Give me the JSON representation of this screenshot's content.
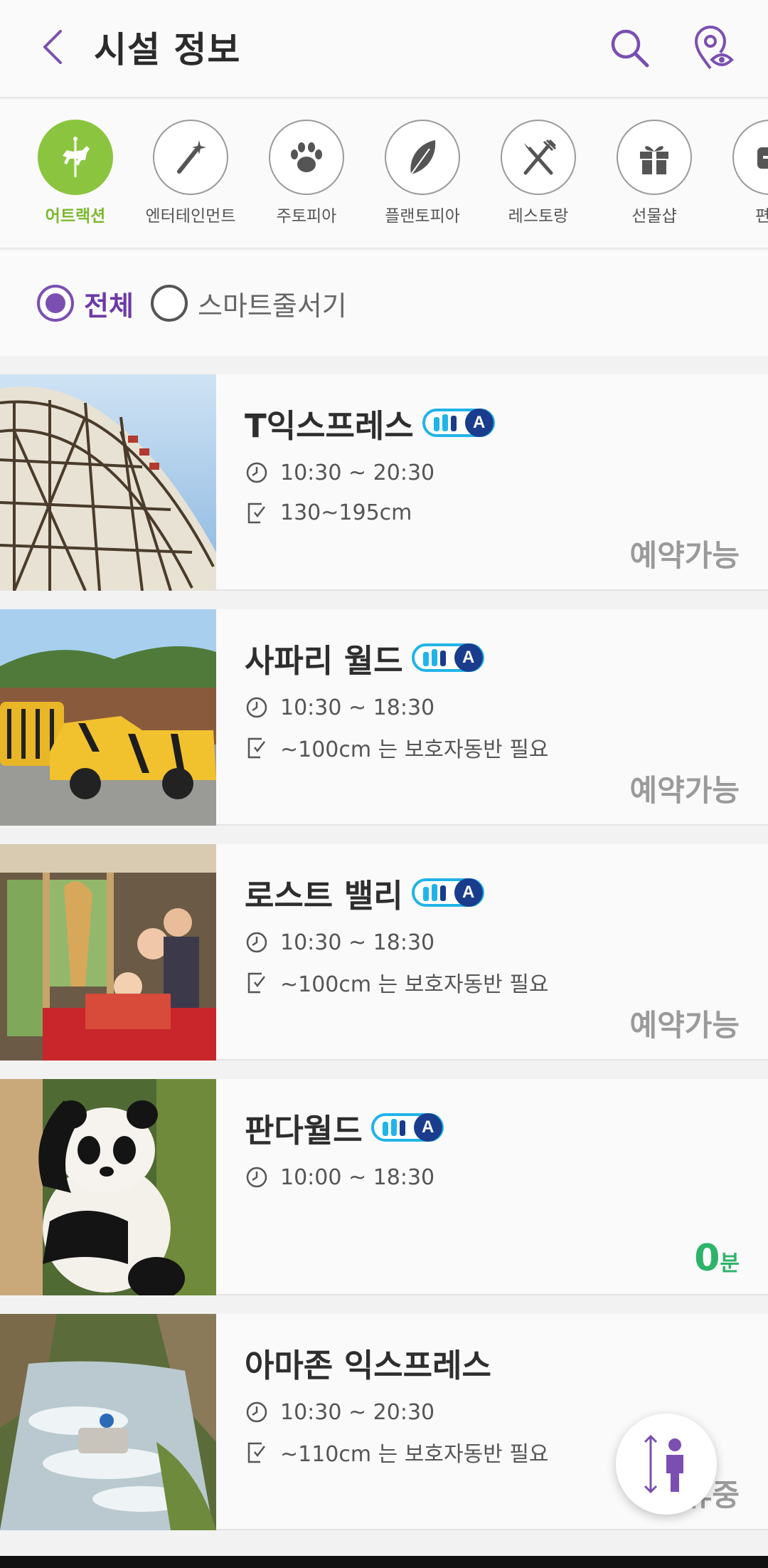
{
  "header": {
    "title": "시설 정보",
    "back_icon": "chevron-left-icon",
    "search_icon": "search-icon",
    "map_icon": "location-eye-icon"
  },
  "categories": [
    {
      "label": "어트랙션",
      "icon": "carousel-horse-icon",
      "active": true
    },
    {
      "label": "엔터테인먼트",
      "icon": "magic-wand-icon",
      "active": false
    },
    {
      "label": "주토피아",
      "icon": "paw-icon",
      "active": false
    },
    {
      "label": "플랜토피아",
      "icon": "leaf-icon",
      "active": false
    },
    {
      "label": "레스토랑",
      "icon": "fork-knife-icon",
      "active": false
    },
    {
      "label": "선물샵",
      "icon": "gift-icon",
      "active": false
    },
    {
      "label": "편의",
      "icon": "convenience-icon",
      "active": false
    }
  ],
  "filter": {
    "all_label": "전체",
    "smart_label": "스마트줄서기",
    "selected": "전체"
  },
  "facilities": [
    {
      "name": "T익스프레스",
      "hours": "10:30 ~ 20:30",
      "height": "130~195cm",
      "status": "예약가능",
      "badge": true
    },
    {
      "name": "사파리 월드",
      "hours": "10:30 ~ 18:30",
      "height": "~100cm 는 보호자동반 필요",
      "status": "예약가능",
      "badge": true
    },
    {
      "name": "로스트 밸리",
      "hours": "10:30 ~ 18:30",
      "height": "~100cm 는 보호자동반 필요",
      "status": "예약가능",
      "badge": true
    },
    {
      "name": "판다월드",
      "hours": "10:00 ~ 18:30",
      "height": "",
      "wait_num": "0",
      "wait_unit": "분",
      "badge": true
    },
    {
      "name": "아마존 익스프레스",
      "hours": "10:30 ~ 20:30",
      "height": "~110cm 는 보호자동반 필요",
      "status": "운휴중",
      "badge": false
    }
  ],
  "badge_letter": "A",
  "fab_icon": "height-check-person-icon",
  "colors": {
    "purple": "#7b4fb1",
    "green_active": "#8bc53f",
    "wait_green": "#2db36a",
    "badge_blue": "#21b4e8",
    "badge_navy": "#1a3c8c"
  }
}
